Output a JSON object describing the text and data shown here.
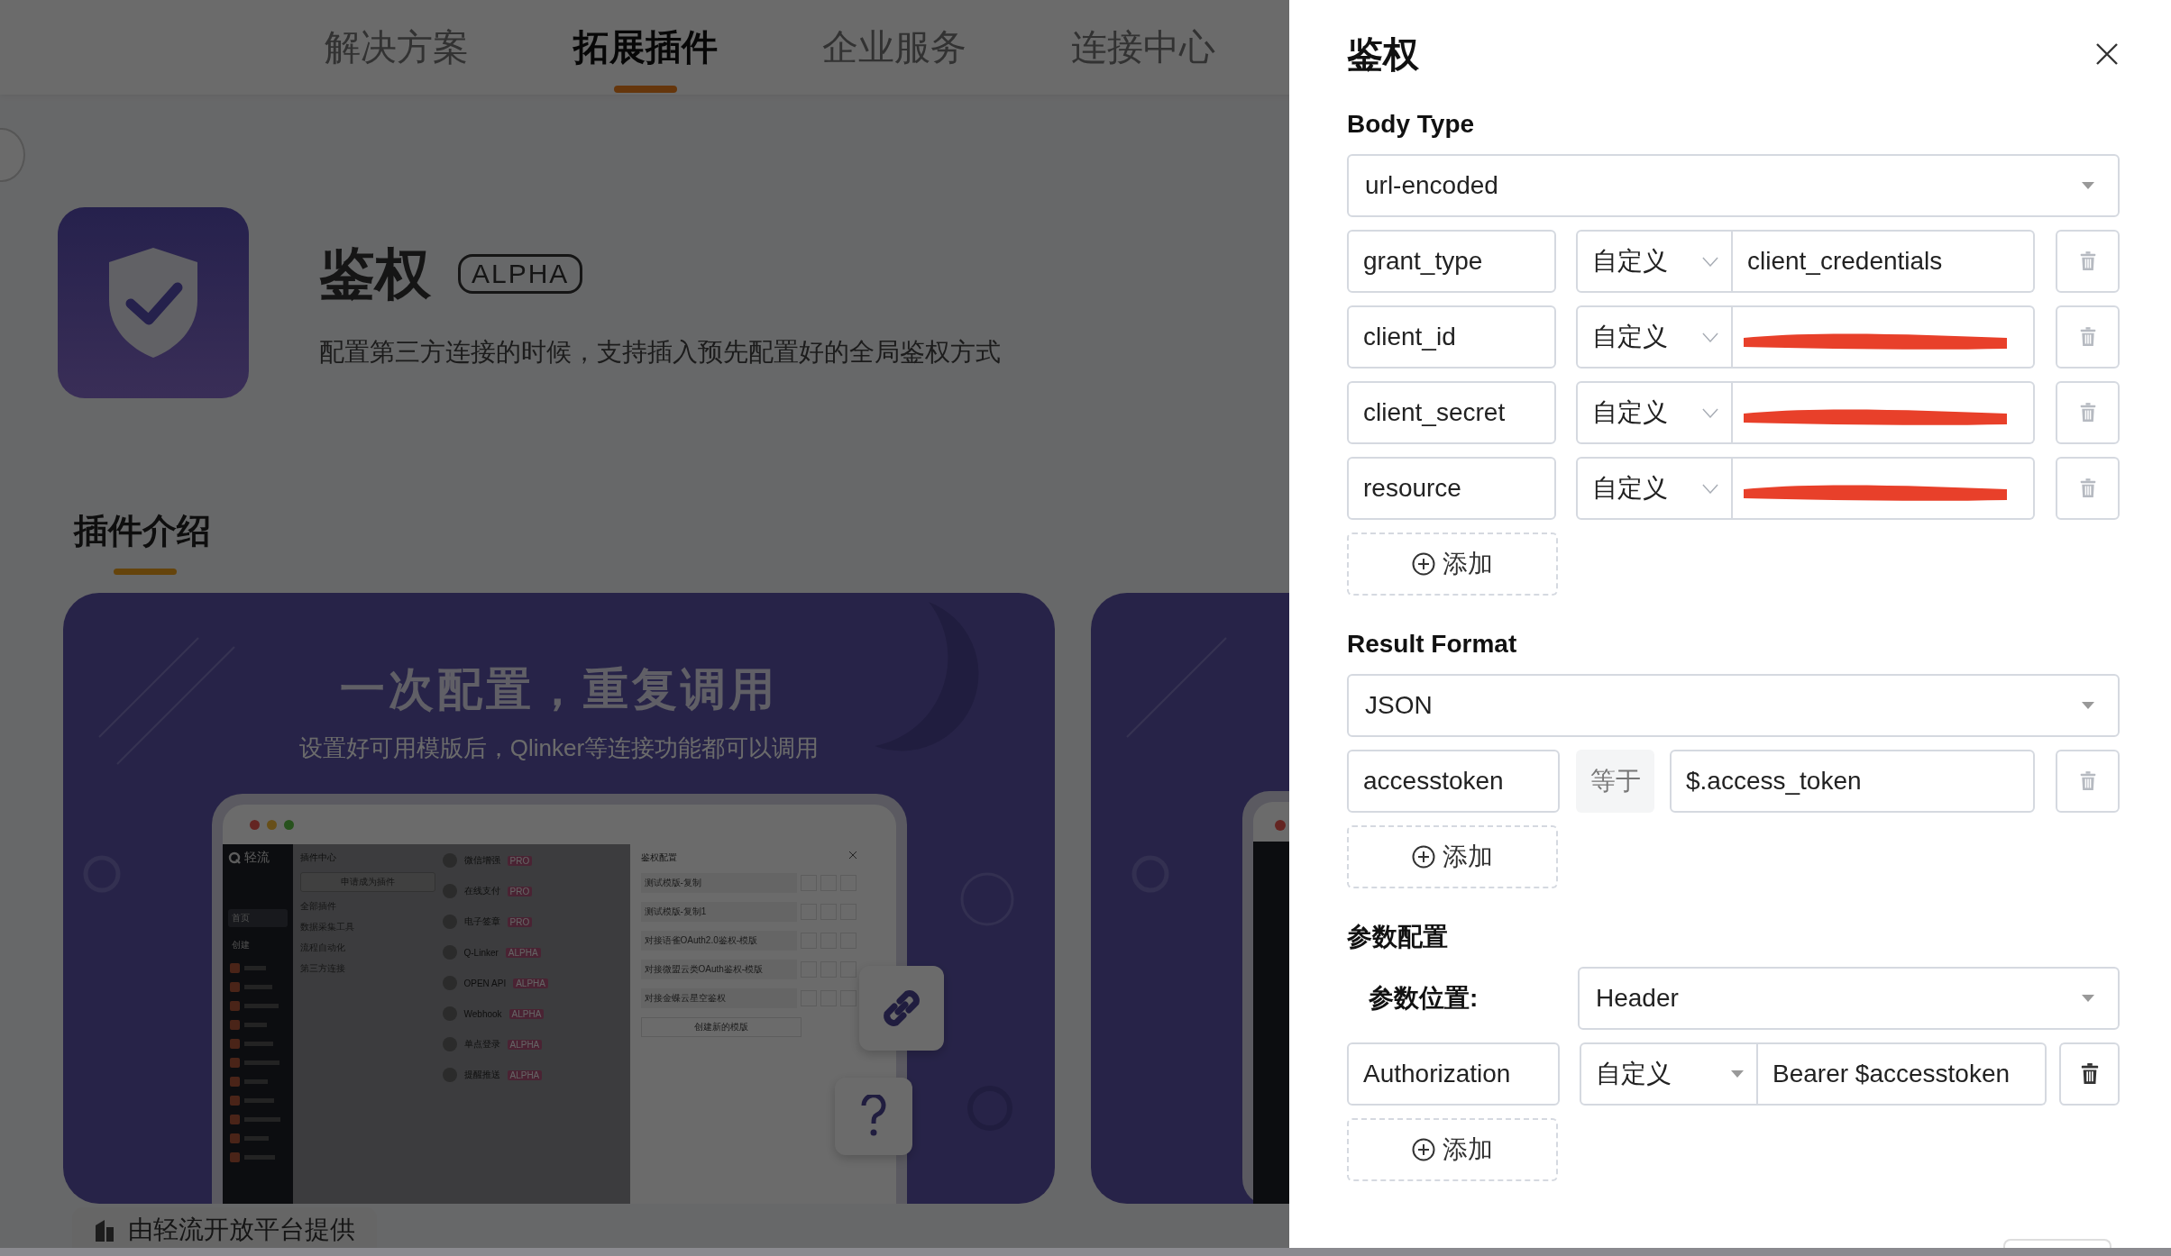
{
  "nav": {
    "tabs": [
      {
        "label": "解决方案",
        "selected": false
      },
      {
        "label": "拓展插件",
        "selected": true
      },
      {
        "label": "企业服务",
        "selected": false
      },
      {
        "label": "连接中心",
        "selected": false
      }
    ]
  },
  "plugin": {
    "title": "鉴权",
    "badge": "ALPHA",
    "description": "配置第三方连接的时候，支持插入预先配置好的全局鉴权方式"
  },
  "intro": {
    "heading": "插件介绍",
    "card": {
      "headline": "一次配置，重复调用",
      "subtitle": "设置好可用模版后，Qlinker等连接功能都可以调用",
      "mockup": {
        "brand": "轻流",
        "nav": [
          "首页",
          "创建"
        ],
        "panel_title": "插件中心",
        "apply_button": "申请成为插件",
        "categories": [
          "全部插件",
          "数据采集工具",
          "流程自动化",
          "第三方连接"
        ],
        "plugins": [
          {
            "name": "微信增强",
            "badge": "PRO"
          },
          {
            "name": "在线支付",
            "badge": "PRO"
          },
          {
            "name": "电子签章",
            "badge": "PRO"
          },
          {
            "name": "Q-Linker",
            "badge": "ALPHA"
          },
          {
            "name": "OPEN API",
            "badge": "ALPHA"
          },
          {
            "name": "Webhook",
            "badge": "ALPHA"
          },
          {
            "name": "单点登录",
            "badge": "ALPHA"
          },
          {
            "name": "提醒推送",
            "badge": "ALPHA"
          }
        ],
        "config": {
          "title": "鉴权配置",
          "templates": [
            "测试模版-复制",
            "测试模版-复制1",
            "对接语雀OAuth2.0鉴权-模版",
            "对接微盟云类OAuth鉴权-模版",
            "对接金蝶云星空鉴权"
          ],
          "create_button": "创建新的模版"
        }
      }
    }
  },
  "footer": {
    "text": "由轻流开放平台提供"
  },
  "drawer": {
    "title": "鉴权",
    "sections": [
      {
        "label": "Body Type",
        "select": "url-encoded",
        "rows": [
          {
            "kind": "mapping",
            "key": "grant_type",
            "mode": "自定义",
            "value": "client_credentials",
            "redacted": false
          },
          {
            "kind": "mapping",
            "key": "client_id",
            "mode": "自定义",
            "redacted": true
          },
          {
            "kind": "mapping",
            "key": "client_secret",
            "mode": "自定义",
            "redacted": true
          },
          {
            "kind": "mapping",
            "key": "resource",
            "mode": "自定义",
            "redacted": true
          }
        ],
        "add_button": "添加"
      },
      {
        "label": "Result Format",
        "select": "JSON",
        "rows": [
          {
            "kind": "operator",
            "key": "accesstoken",
            "operator": "等于",
            "value": "$.access_token"
          }
        ],
        "add_button": "添加"
      },
      {
        "label": "参数配置",
        "position_label": "参数位置:",
        "select": "Header",
        "rows": [
          {
            "kind": "header",
            "key": "Authorization",
            "mode": "自定义",
            "value": "Bearer $accesstoken"
          }
        ],
        "add_button": "添加"
      }
    ]
  }
}
